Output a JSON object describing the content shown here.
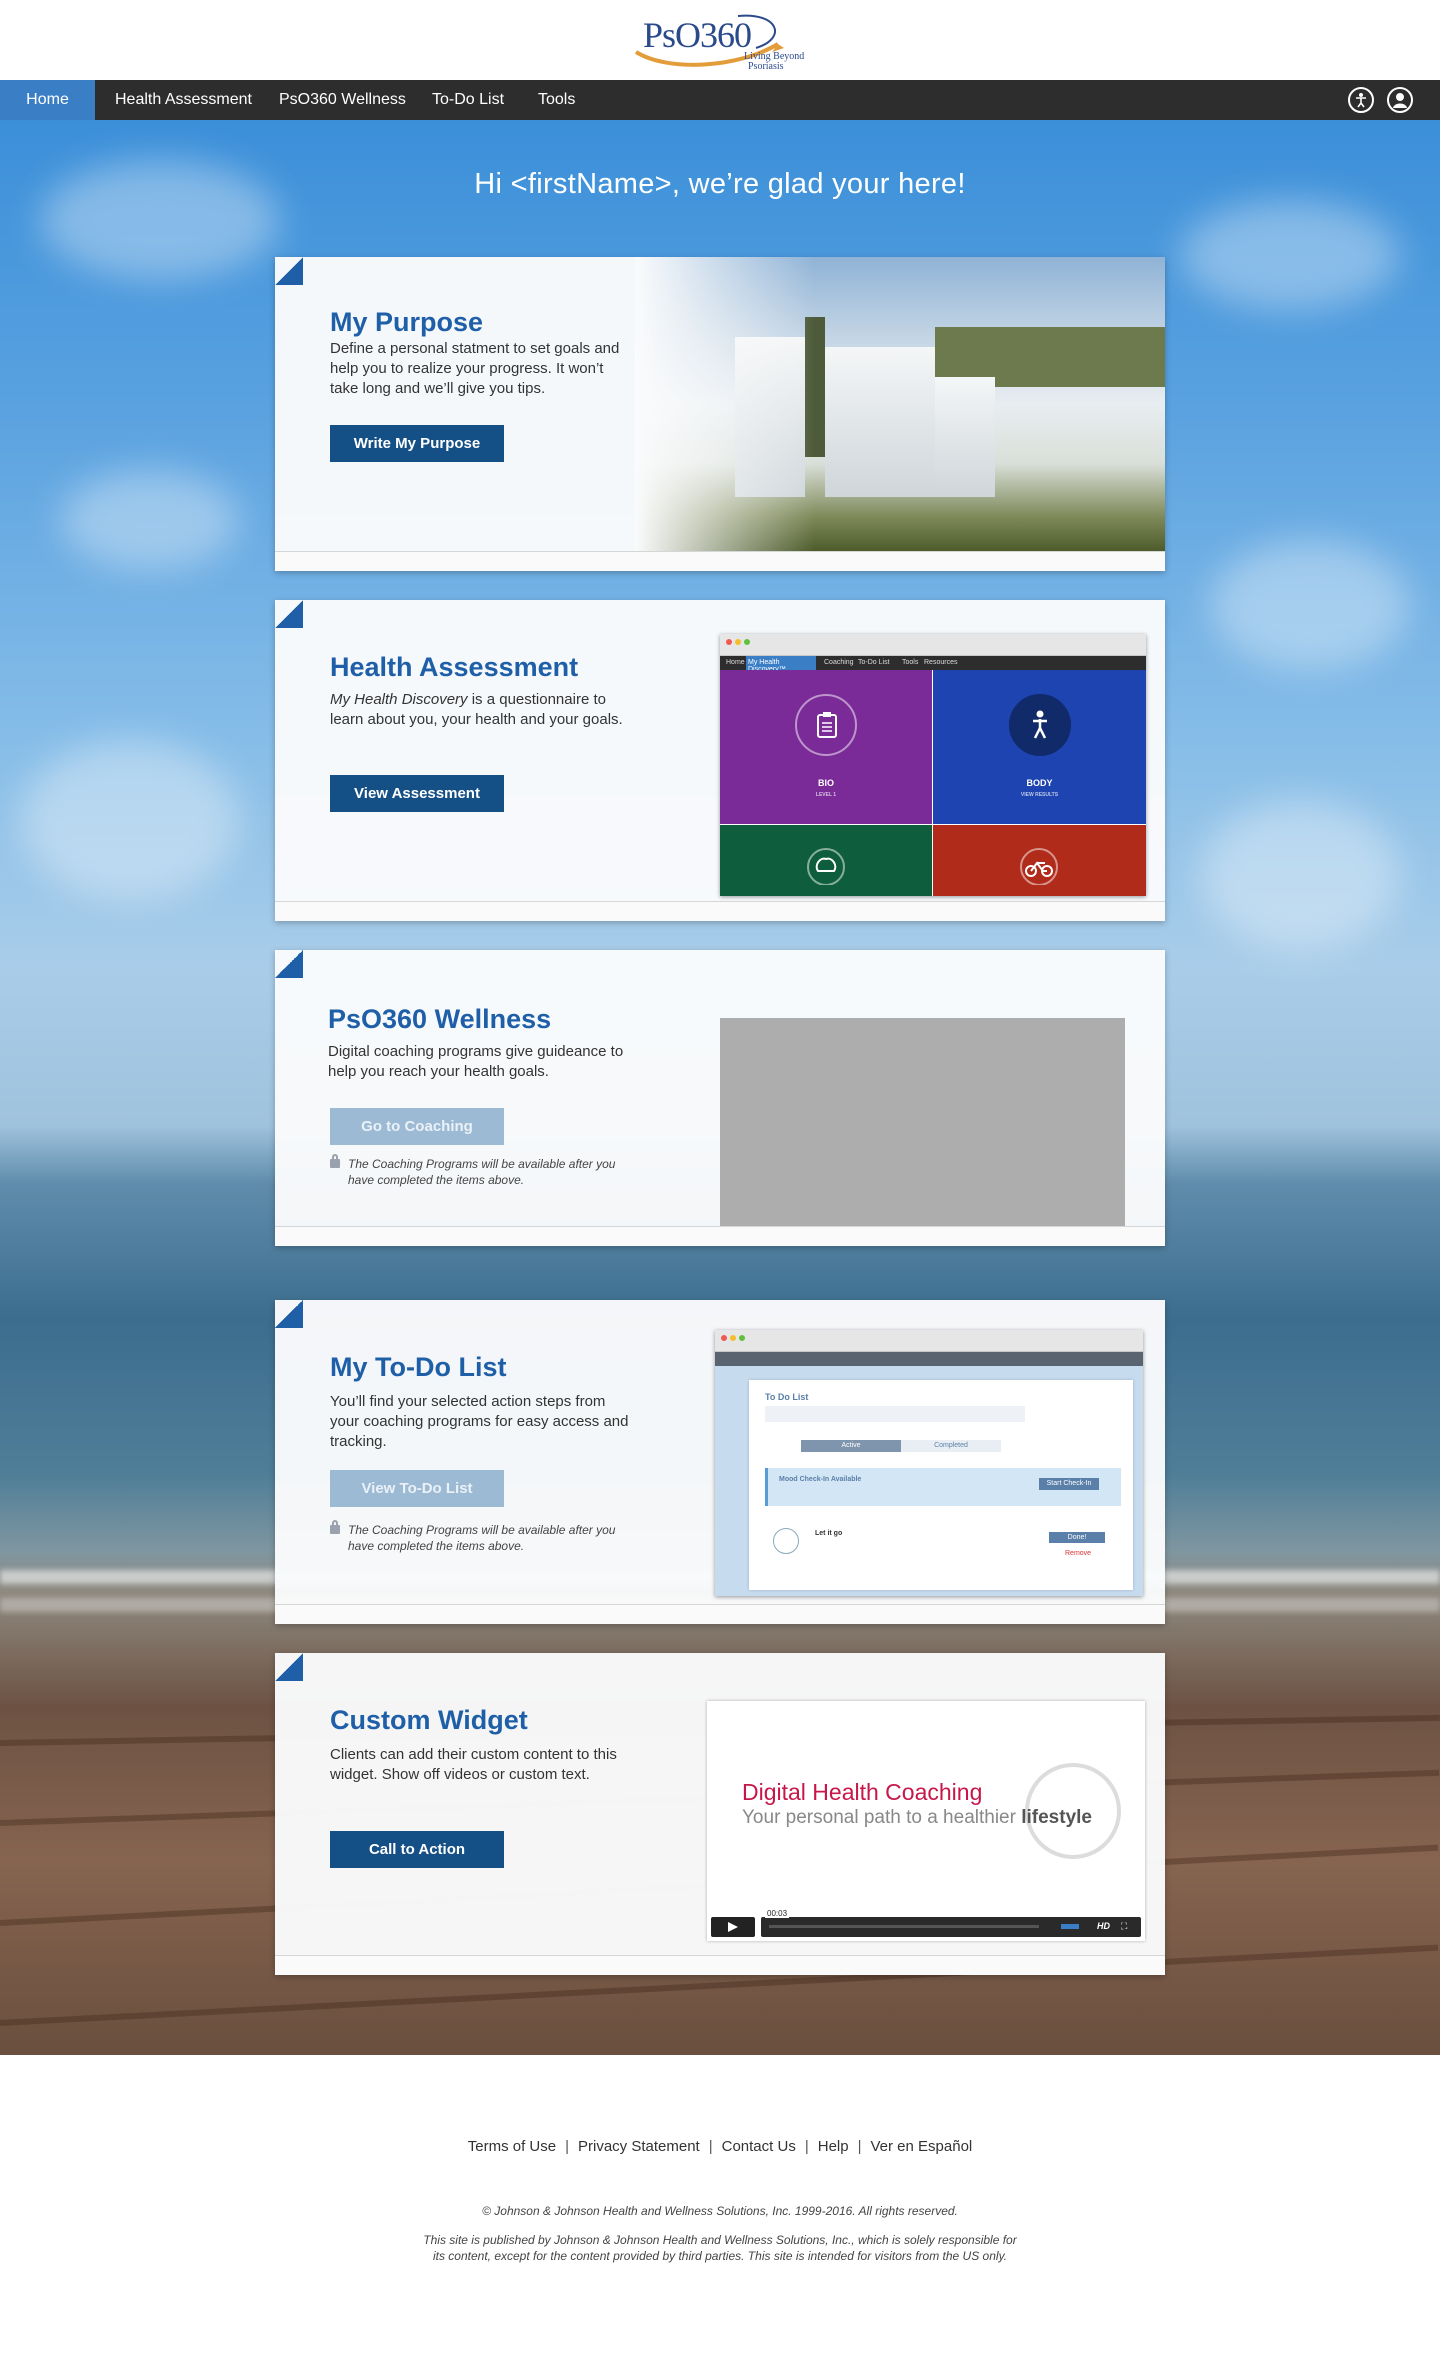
{
  "header": {
    "logo_text": "PsO360",
    "logo_tagline_1": "Living Beyond",
    "logo_tagline_2": "Psoriasis"
  },
  "nav": {
    "items": [
      {
        "label": "Home",
        "active": true
      },
      {
        "label": "Health Assessment"
      },
      {
        "label": "PsO360 Wellness"
      },
      {
        "label": "To-Do List"
      },
      {
        "label": "Tools"
      }
    ],
    "icons": [
      "accessibility-icon",
      "user-profile-icon"
    ]
  },
  "greeting": "Hi <firstName>, we’re glad your here!",
  "cards": {
    "purpose": {
      "title": "My Purpose",
      "desc": "Define a personal statment to set goals and help you to realize your progress.  It won’t take long and we’ll give you tips.",
      "button": "Write My Purpose"
    },
    "assessment": {
      "title": "Health Assessment",
      "desc_em": "My Health Discovery",
      "desc": " is a questionnaire to learn about you, your health and your goals.",
      "button": "View Assessment",
      "preview": {
        "nav": [
          "Home",
          "My Health Discovery™",
          "Coaching",
          "To-Do List",
          "Tools",
          "Resources"
        ],
        "tiles": [
          {
            "label": "BIO",
            "sub": "LEVEL 1",
            "color": "#7a2b98"
          },
          {
            "label": "BODY",
            "sub": "VIEW RESULTS",
            "color": "#1d44b0"
          },
          {
            "label": "",
            "sub": "",
            "color": "#0e5d3c"
          },
          {
            "label": "",
            "sub": "",
            "color": "#b02b1a"
          }
        ]
      }
    },
    "wellness": {
      "title": "PsO360 Wellness",
      "desc": "Digital coaching programs give guideance to help you reach your health goals.",
      "button": "Go to Coaching",
      "note": "The Coaching Programs will be available after you have completed the items above."
    },
    "todo": {
      "title": "My To-Do List",
      "desc": "You’ll find your selected action steps from your coaching programs for easy access and tracking.",
      "button": "View To-Do List",
      "note": "The Coaching Programs will be available after you have completed the items above.",
      "preview": {
        "heading": "To Do List",
        "tabs": [
          "Active",
          "Completed"
        ],
        "banner": "Mood Check-In Available",
        "banner_btn": "Start Check-In",
        "item": "Let it go",
        "item_btn": "Done!",
        "remove": "Remove"
      }
    },
    "custom": {
      "title": "Custom Widget",
      "desc": "Clients can add their custom content to this widget.  Show off videos or custom text.",
      "button": "Call to Action",
      "video": {
        "title": "Digital Health Coaching",
        "subtitle": "Your personal path to a healthier",
        "subtitle_bold": "lifestyle",
        "time": "00:03",
        "hd": "HD"
      }
    }
  },
  "footer": {
    "links": [
      "Terms of Use",
      "Privacy Statement",
      "Contact Us",
      "Help",
      "Ver en Español"
    ],
    "copyright": "© Johnson & Johnson Health and Wellness Solutions, Inc. 1999-2016. All rights reserved.",
    "disclaimer": "This site is published by Johnson & Johnson Health and Wellness Solutions, Inc., which is solely responsible for its content, except for the content provided by third parties.  This site is intended for visitors from the US only."
  },
  "colors": {
    "brand_blue": "#1f5fa8",
    "button_blue": "#144f85",
    "nav_bg": "#2d2d2d",
    "nav_active": "#3a7ec6",
    "video_title": "#c8164a"
  }
}
